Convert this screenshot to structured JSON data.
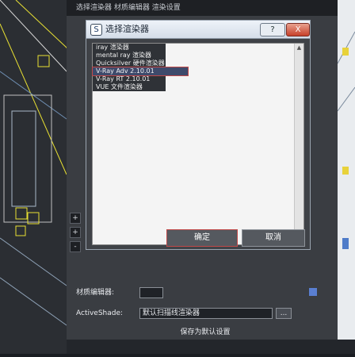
{
  "background": {
    "top_strip_text": "选择渲染器 材质编辑器 渲染设置"
  },
  "dialog": {
    "title": "选择渲染器",
    "help_label": "?",
    "close_label": "X",
    "renderers": [
      {
        "label": "iray 渲染器",
        "selected": false
      },
      {
        "label": "mental ray 渲染器",
        "selected": false
      },
      {
        "label": "Quicksilver 硬件渲染器",
        "selected": false
      },
      {
        "label": "V-Ray Adv 2.10.01",
        "selected": true
      },
      {
        "label": "V-Ray RT 2.10.01",
        "selected": false
      },
      {
        "label": "VUE 文件渲染器",
        "selected": false
      }
    ],
    "ok_label": "确定",
    "cancel_label": "取消"
  },
  "assign": {
    "material_editor_label": "材质编辑器:",
    "activeshade_label": "ActiveShade:",
    "activeshade_value": "默认扫描线渲染器",
    "dots_label": "...",
    "save_default_label": "保存为默认设置"
  },
  "side_buttons": {
    "plus1": "+",
    "plus2": "+",
    "minus": "-"
  },
  "colors": {
    "accent_red": "#c04a4a",
    "selection_blue": "#3e4a6b"
  }
}
